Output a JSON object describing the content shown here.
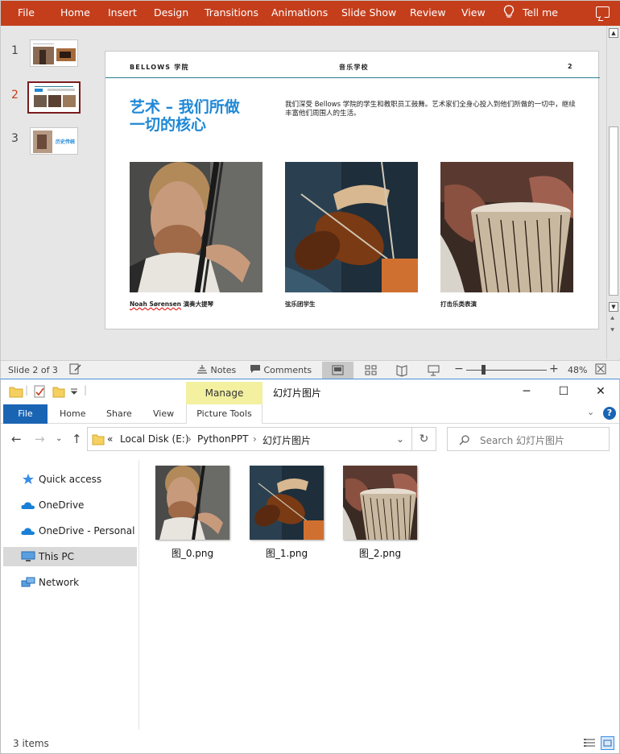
{
  "powerpoint": {
    "ribbon_tabs": [
      "File",
      "Home",
      "Insert",
      "Design",
      "Transitions",
      "Animations",
      "Slide Show",
      "Review",
      "View"
    ],
    "tell_me": "Tell me",
    "thumbnails": [
      {
        "number": "1"
      },
      {
        "number": "2"
      },
      {
        "number": "3",
        "mini_title": "历史传统"
      }
    ],
    "slide": {
      "header_left": "BELLOWS 学院",
      "header_center": "音乐学校",
      "header_right": "2",
      "title": "艺术 – 我们所做一切的核心",
      "body": "我们深受 Bellows 学院的学生和教职员工鼓舞。艺术家们全身心投入到他们所做的一切中，继续丰富他们周围人的生活。",
      "captions": [
        {
          "name": "Noah Sørensen",
          "rest": " 演奏大提琴"
        },
        {
          "name": "",
          "rest": "弦乐团学生"
        },
        {
          "name": "",
          "rest": "打击乐类表演"
        }
      ]
    },
    "status": {
      "slide_info": "Slide 2 of 3",
      "notes": "Notes",
      "comments": "Comments",
      "zoom": "48%"
    }
  },
  "explorer": {
    "manage_tab": "Manage",
    "window_title": "幻灯片图片",
    "tabs": [
      "Home",
      "Share",
      "View"
    ],
    "file_tab": "File",
    "picture_tools": "Picture Tools",
    "breadcrumb": [
      "«",
      "Local Disk (E:)",
      "›",
      "PythonPPT",
      "›",
      "幻灯片图片"
    ],
    "search_placeholder": "Search 幻灯片图片",
    "nav_items": [
      "Quick access",
      "OneDrive",
      "OneDrive - Personal",
      "This PC",
      "Network"
    ],
    "files": [
      "图_0.png",
      "图_1.png",
      "图_2.png"
    ],
    "status_count": "3 items"
  },
  "colors": {
    "ppt_accent": "#c43e1c",
    "slide_title_blue": "#1f88d6",
    "explorer_file_tab": "#1a64b4",
    "manage_tab_bg": "#f3f0a0"
  }
}
